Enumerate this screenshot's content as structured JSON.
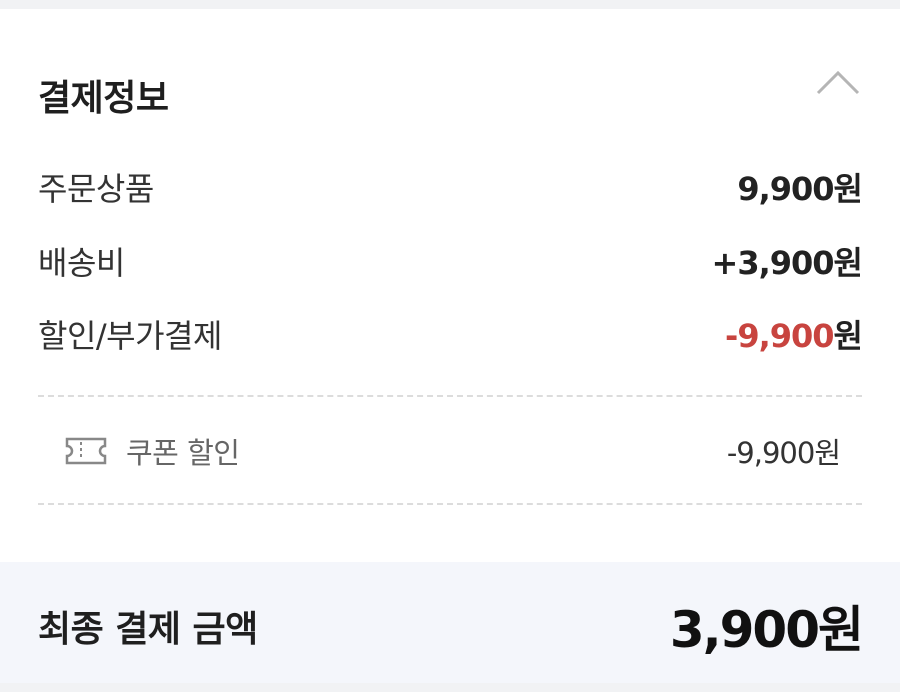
{
  "payment": {
    "title": "결제정보",
    "collapse_icon": "chevron-up-icon",
    "rows": [
      {
        "label": "주문상품",
        "value": "9,900원"
      },
      {
        "label": "배송비",
        "value": "+3,900원"
      },
      {
        "label": "할인/부가결제",
        "value_amount": "-9,900",
        "value_unit": "원"
      }
    ],
    "coupon": {
      "icon": "ticket-icon",
      "label": "쿠폰 할인",
      "value": "-9,900원"
    },
    "total": {
      "label": "최종 결제 금액",
      "value": "3,900원"
    },
    "colors": {
      "discount": "#c8443f",
      "total_bg": "#f4f6fb",
      "page_bg": "#f1f2f4"
    }
  }
}
